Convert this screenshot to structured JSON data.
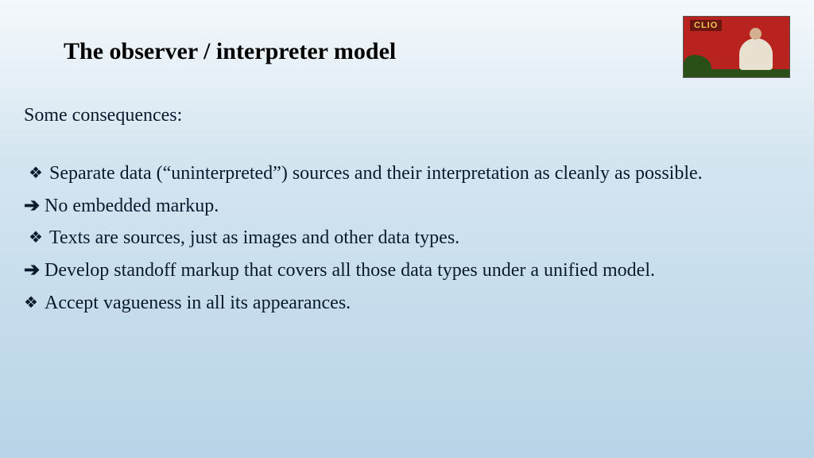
{
  "header": {
    "title": "The observer / interpreter model",
    "logo_label": "CLIO"
  },
  "content": {
    "intro": "Some consequences:",
    "items": [
      {
        "icon": "diamond",
        "text": "Separate data (“uninterpreted”) sources and their interpretation as cleanly as possible.",
        "indent": "slight"
      },
      {
        "icon": "arrow",
        "text": "No embedded markup.",
        "indent": "none"
      },
      {
        "icon": "diamond",
        "text": "Texts are sources, just as images and other data types.",
        "indent": "slight"
      },
      {
        "icon": "arrow",
        "text": "Develop standoff markup that covers all those data types under a unified model.",
        "indent": "none"
      },
      {
        "icon": "diamond",
        "text": "Accept vagueness in all its appearances.",
        "indent": "none"
      }
    ]
  }
}
